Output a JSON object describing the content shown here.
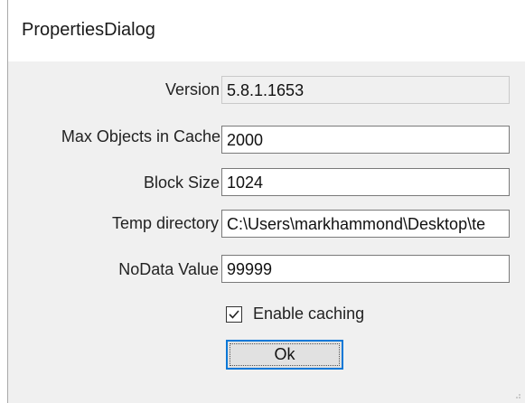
{
  "window": {
    "title": "PropertiesDialog"
  },
  "form": {
    "version": {
      "label": "Version",
      "value": "5.8.1.1653"
    },
    "max_objects": {
      "label": "Max Objects in Cache",
      "value": "2000"
    },
    "block_size": {
      "label": "Block Size",
      "value": "1024"
    },
    "temp_directory": {
      "label": "Temp directory",
      "value": "C:\\Users\\markhammond\\Desktop\\te"
    },
    "nodata_value": {
      "label": "NoData Value",
      "value": "99999"
    },
    "enable_caching": {
      "label": "Enable caching",
      "checked": true
    },
    "ok_button": {
      "label": "Ok"
    }
  }
}
